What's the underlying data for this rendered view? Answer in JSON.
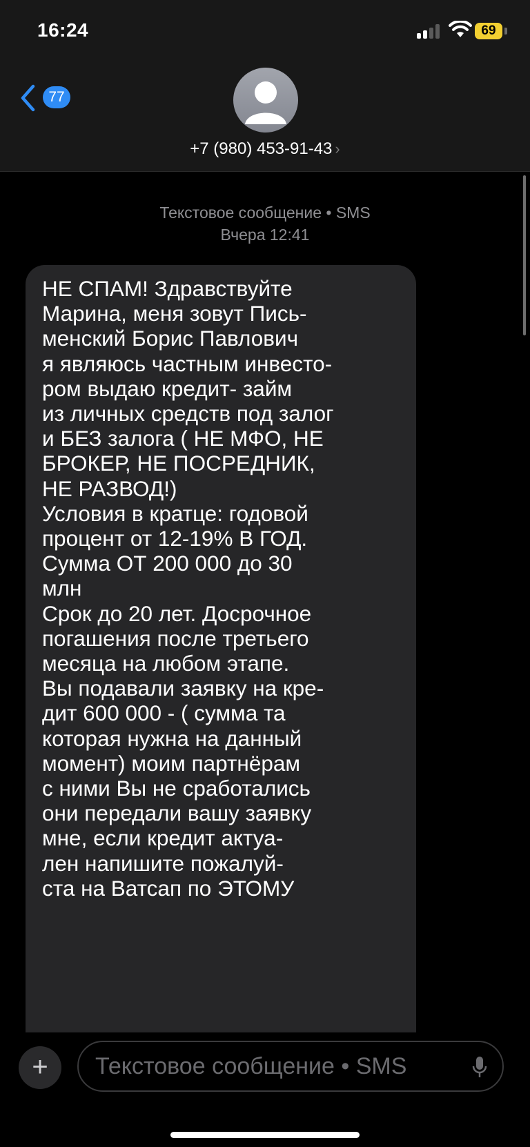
{
  "status_bar": {
    "time": "16:24",
    "battery": "69"
  },
  "header": {
    "back_badge": "77",
    "contact_number": "+7 (980) 453-91-43",
    "contact_chevron": "›"
  },
  "thread": {
    "meta_label": "Текстовое сообщение • SMS",
    "meta_time": "Вчера 12:41",
    "message_lines": [
      "НЕ СПАМ! Здравствуйте",
      "Марина, меня зовут Пись-",
      "менский Борис Павлович",
      "я являюсь частным инвесто-",
      "ром выдаю кредит- займ",
      "из личных средств под залог",
      "и БЕЗ залога ( НЕ МФО, НЕ",
      "БРОКЕР, НЕ ПОСРЕДНИК,",
      "НЕ РАЗВОД!)",
      "Условия в кратце: годовой",
      "процент от 12-19% В ГОД.",
      "Сумма ОТ 200 000 до 30",
      "млн",
      "Срок  до 20 лет. Досрочное",
      "погашения после третьего",
      "месяца на любом этапе.",
      "Вы подавали заявку на кре-",
      "дит 600 000 - ( сумма та",
      "которая нужна на данный",
      "момент) моим партнёрам",
      "с ними Вы не сработались",
      "они передали вашу заявку",
      "мне, если кредит актуа-",
      "лен напишите пожалуй-",
      "ста на Ватсап по ЭТОМУ"
    ]
  },
  "composer": {
    "plus_label": "+",
    "placeholder": "Текстовое сообщение • SMS"
  },
  "icons": {
    "back": "chevron-left-icon",
    "avatar": "person-icon",
    "mic": "microphone-icon",
    "signal": "cellular-signal-icon",
    "wifi": "wifi-icon"
  },
  "colors": {
    "accent": "#2f8cf5",
    "battery": "#f3d031",
    "bubble": "#262628"
  }
}
